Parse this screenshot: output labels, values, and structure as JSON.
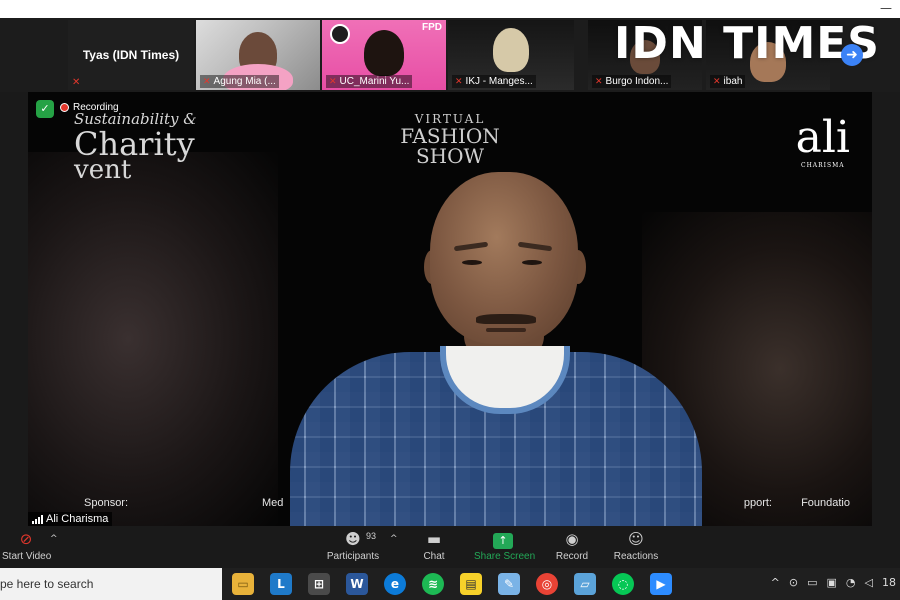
{
  "watermark": {
    "brand": "IDN TIMES"
  },
  "strip": {
    "text_tile": {
      "name": "Tyas (IDN Times)"
    },
    "tiles": [
      {
        "name": "Agung Mia (..."
      },
      {
        "name": "UC_Marini Yu...",
        "badge": "FPD"
      },
      {
        "name": "IKJ - Manges..."
      },
      {
        "name": "Burgo Indon..."
      },
      {
        "name": "ibah"
      }
    ]
  },
  "main": {
    "status": "Recording",
    "speaker": "Ali Charisma",
    "backdrop": {
      "left_line1": "Sustainability &",
      "left_line2": "Charity",
      "left_line3": "vent",
      "center_line1": "VIRTUAL",
      "center_line2": "FASHION",
      "center_line3": "SHOW",
      "logo": "ali",
      "logo_sub": "CHARISMA",
      "sponsor": "Sponsor:",
      "media": "Med",
      "support": "pport:",
      "foundation": "Foundatio"
    }
  },
  "toolbar": {
    "start_video": "Start Video",
    "participants": "Participants",
    "participants_count": "93",
    "chat": "Chat",
    "share_screen": "Share Screen",
    "record": "Record",
    "reactions": "Reactions"
  },
  "taskbar": {
    "search_placeholder": "pe here to search",
    "clock_fragment": "18"
  },
  "colors": {
    "recording_red": "#e2372c",
    "share_green": "#23a857",
    "verified_green": "#25a245"
  }
}
